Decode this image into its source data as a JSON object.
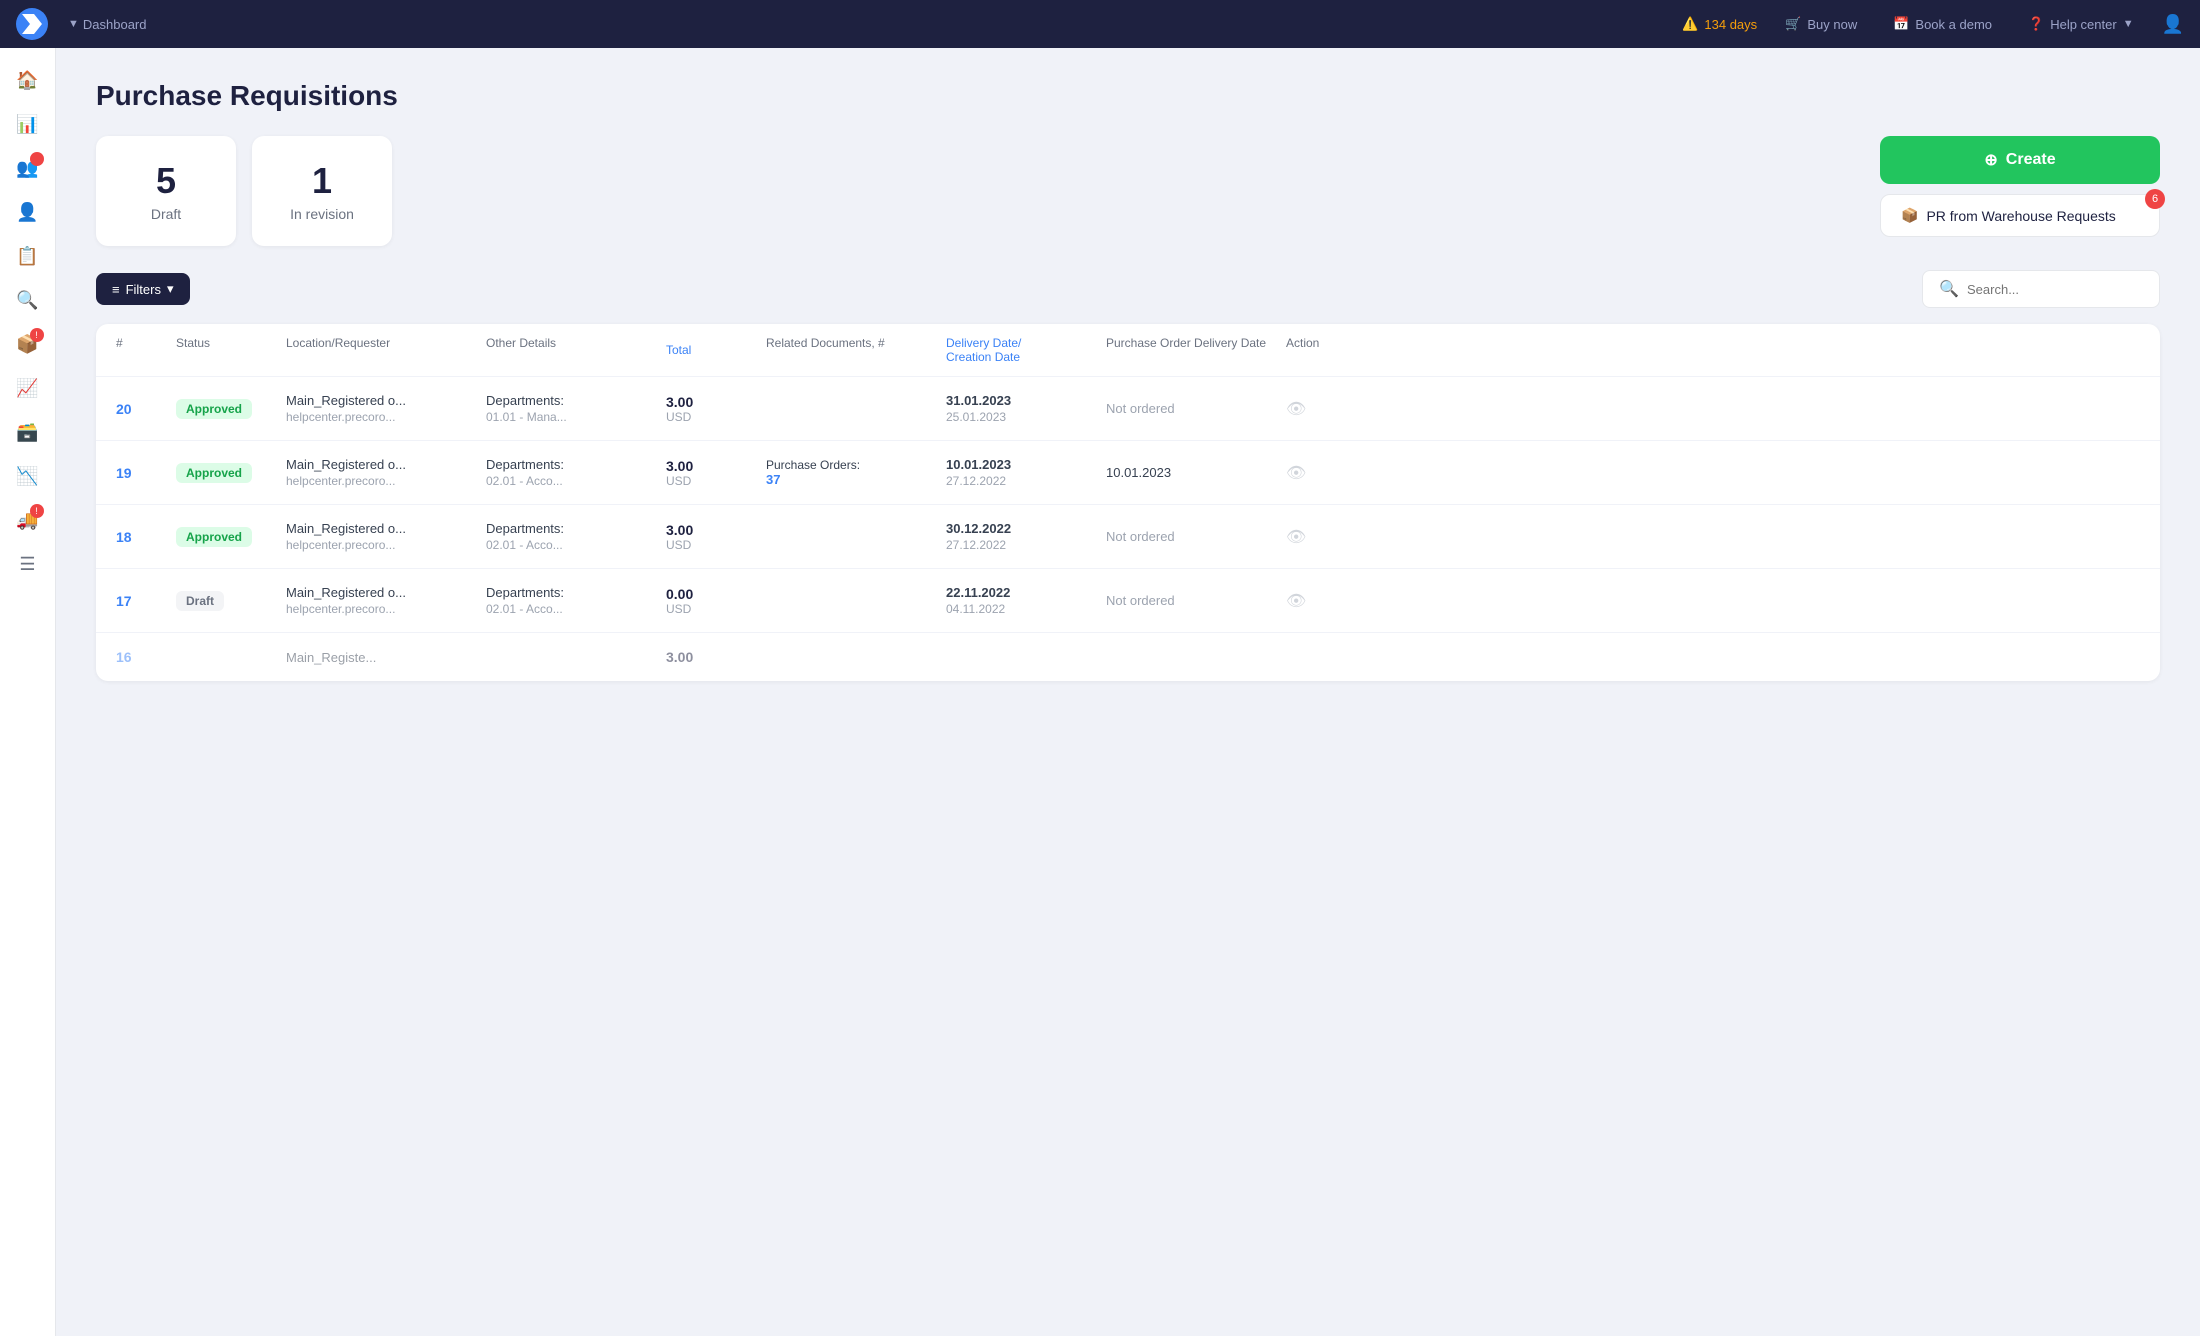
{
  "topNav": {
    "dashboard": "Dashboard",
    "alert": "134 days",
    "buyNow": "Buy now",
    "bookDemo": "Book a demo",
    "helpCenter": "Help center"
  },
  "page": {
    "title": "Purchase Requisitions"
  },
  "summary": {
    "draft": {
      "count": "5",
      "label": "Draft"
    },
    "inRevision": {
      "count": "1",
      "label": "In revision"
    }
  },
  "buttons": {
    "create": "Create",
    "warehouseRequests": "PR from Warehouse Requests",
    "warehouseBadge": "6"
  },
  "filters": {
    "label": "Filters",
    "search": {
      "placeholder": "Search..."
    }
  },
  "table": {
    "columns": {
      "number": "#",
      "status": "Status",
      "locationRequester": "Location/Requester",
      "otherDetails": "Other Details",
      "total": "Total",
      "relatedDocuments": "Related Documents, #",
      "deliveryDate": "Delivery Date/",
      "deliveryDateSub": "Creation Date",
      "poDeliveryDate": "Purchase Order Delivery Date",
      "action": "Action"
    },
    "rows": [
      {
        "id": "20",
        "status": "Approved",
        "statusType": "approved",
        "locationMain": "Main_Registered o...",
        "locationSub": "helpcenter.precoro...",
        "detailsMain": "Departments:",
        "detailsSub": "01.01 - Mana...",
        "total": "3.00",
        "currency": "USD",
        "relatedDocuments": "",
        "relatedLink": "",
        "deliveryDate": "31.01.2023",
        "creationDate": "25.01.2023",
        "poDate": "",
        "poStatus": "Not ordered"
      },
      {
        "id": "19",
        "status": "Approved",
        "statusType": "approved",
        "locationMain": "Main_Registered o...",
        "locationSub": "helpcenter.precoro...",
        "detailsMain": "Departments:",
        "detailsSub": "02.01 - Acco...",
        "total": "3.00",
        "currency": "USD",
        "relatedDocuments": "Purchase Orders:",
        "relatedLink": "37",
        "deliveryDate": "10.01.2023",
        "creationDate": "27.12.2022",
        "poDate": "10.01.2023",
        "poStatus": ""
      },
      {
        "id": "18",
        "status": "Approved",
        "statusType": "approved",
        "locationMain": "Main_Registered o...",
        "locationSub": "helpcenter.precoro...",
        "detailsMain": "Departments:",
        "detailsSub": "02.01 - Acco...",
        "total": "3.00",
        "currency": "USD",
        "relatedDocuments": "",
        "relatedLink": "",
        "deliveryDate": "30.12.2022",
        "creationDate": "27.12.2022",
        "poDate": "",
        "poStatus": "Not ordered"
      },
      {
        "id": "17",
        "status": "Draft",
        "statusType": "draft",
        "locationMain": "Main_Registered o...",
        "locationSub": "helpcenter.precoro...",
        "detailsMain": "Departments:",
        "detailsSub": "02.01 - Acco...",
        "total": "0.00",
        "currency": "USD",
        "relatedDocuments": "",
        "relatedLink": "",
        "deliveryDate": "22.11.2022",
        "creationDate": "04.11.2022",
        "poDate": "",
        "poStatus": "Not ordered"
      }
    ]
  },
  "sidebar": {
    "items": [
      {
        "icon": "🏠",
        "name": "home"
      },
      {
        "icon": "📊",
        "name": "analytics"
      },
      {
        "icon": "👥",
        "name": "users"
      },
      {
        "icon": "👤",
        "name": "profile"
      },
      {
        "icon": "📋",
        "name": "tasks",
        "badge": ""
      },
      {
        "icon": "🔍",
        "name": "search"
      },
      {
        "icon": "📦",
        "name": "packages",
        "badge": "!"
      },
      {
        "icon": "📈",
        "name": "reports"
      },
      {
        "icon": "🗃️",
        "name": "database"
      },
      {
        "icon": "📉",
        "name": "trends"
      },
      {
        "icon": "🚚",
        "name": "delivery",
        "badge": "!"
      },
      {
        "icon": "☰",
        "name": "menu"
      }
    ]
  }
}
